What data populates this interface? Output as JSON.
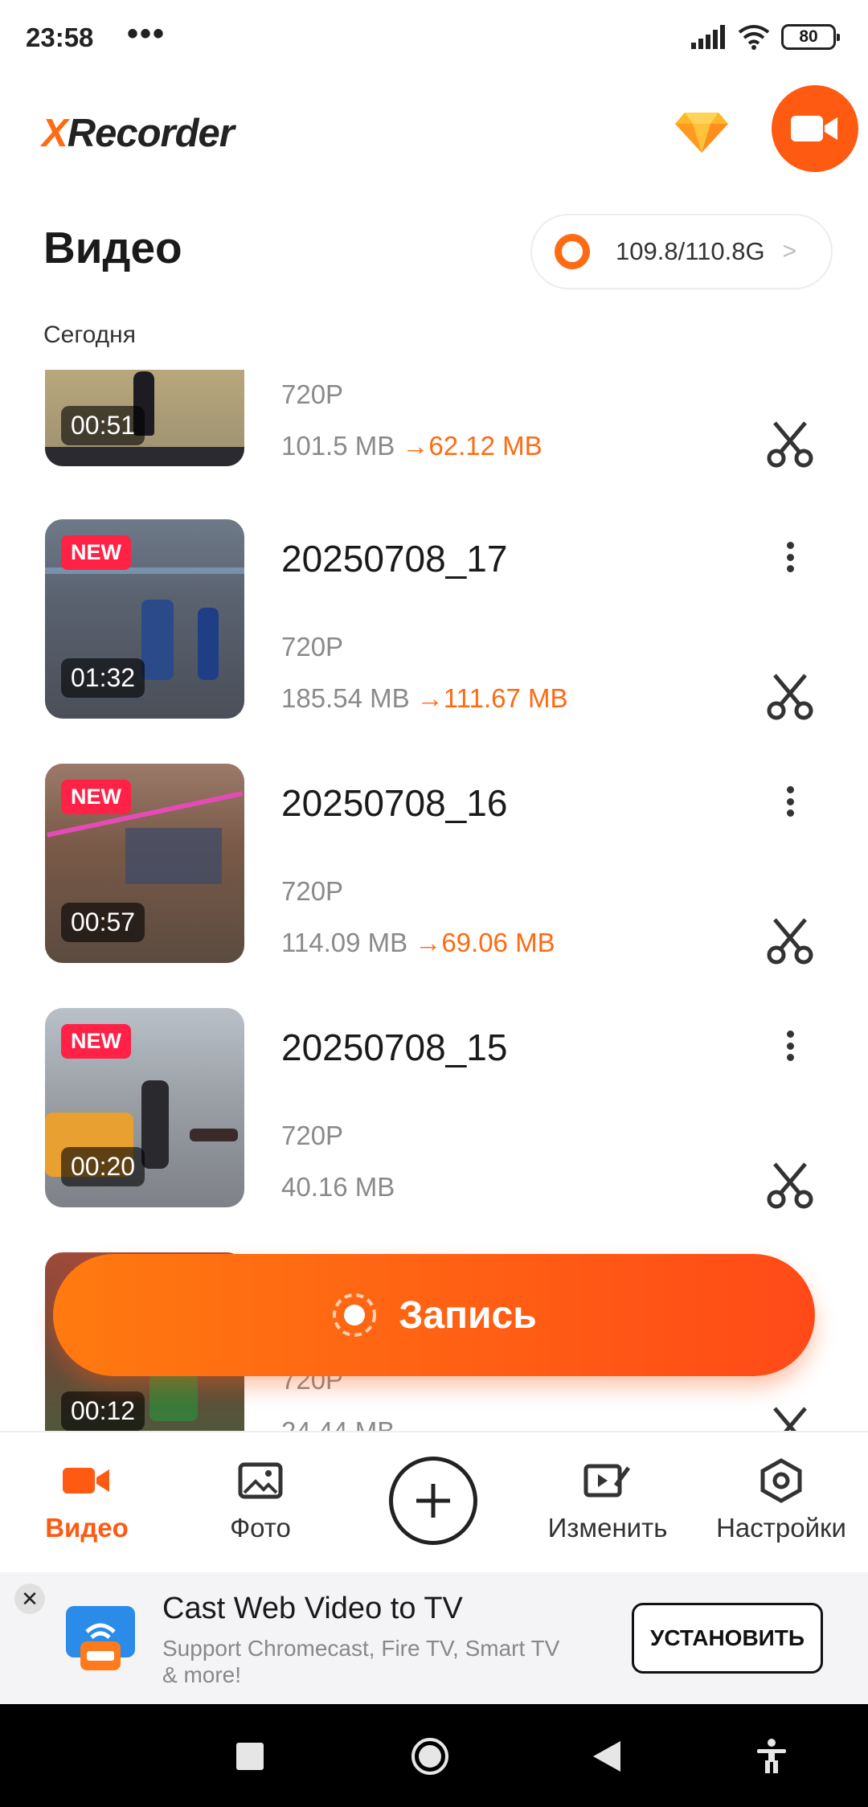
{
  "status_bar": {
    "time": "23:58",
    "more": "•••",
    "battery": "80"
  },
  "header": {
    "brand_x": "X",
    "brand_rest": "Recorder"
  },
  "page": {
    "title": "Видео",
    "storage": "109.8/110.8G",
    "section": "Сегодня"
  },
  "videos": [
    {
      "name": "",
      "duration": "00:51",
      "resolution": "720P",
      "size": "101.5 MB",
      "arrow": "→",
      "compressed": "62.12 MB",
      "is_new": false,
      "badge": ""
    },
    {
      "name": "20250708_17",
      "duration": "01:32",
      "resolution": "720P",
      "size": "185.54 MB",
      "arrow": "→",
      "compressed": "111.67 MB",
      "is_new": true,
      "badge": "NEW"
    },
    {
      "name": "20250708_16",
      "duration": "00:57",
      "resolution": "720P",
      "size": "114.09 MB",
      "arrow": "→",
      "compressed": "69.06 MB",
      "is_new": true,
      "badge": "NEW"
    },
    {
      "name": "20250708_15",
      "duration": "00:20",
      "resolution": "720P",
      "size": "40.16 MB",
      "arrow": "",
      "compressed": "",
      "is_new": true,
      "badge": "NEW"
    },
    {
      "name": "",
      "duration": "00:12",
      "resolution": "720P",
      "size": "24.44 MB",
      "arrow": "",
      "compressed": "",
      "is_new": false,
      "badge": ""
    }
  ],
  "record_button": {
    "label": "Запись"
  },
  "bottom_nav": {
    "items": [
      {
        "label": "Видео",
        "icon": "video-camera-icon",
        "active": true
      },
      {
        "label": "Фото",
        "icon": "photo-icon",
        "active": false
      },
      {
        "label": "Изменить",
        "icon": "edit-video-icon",
        "active": false
      },
      {
        "label": "Настройки",
        "icon": "settings-icon",
        "active": false
      }
    ]
  },
  "ad": {
    "close": "✕",
    "title": "Cast Web Video to TV",
    "description": "Support Chromecast, Fire TV, Smart TV & more!",
    "cta": "УСТАНОВИТЬ"
  },
  "colors": {
    "accent": "#ff5a12",
    "new_badge": "#ff2146",
    "compressed": "#ff6a13"
  }
}
